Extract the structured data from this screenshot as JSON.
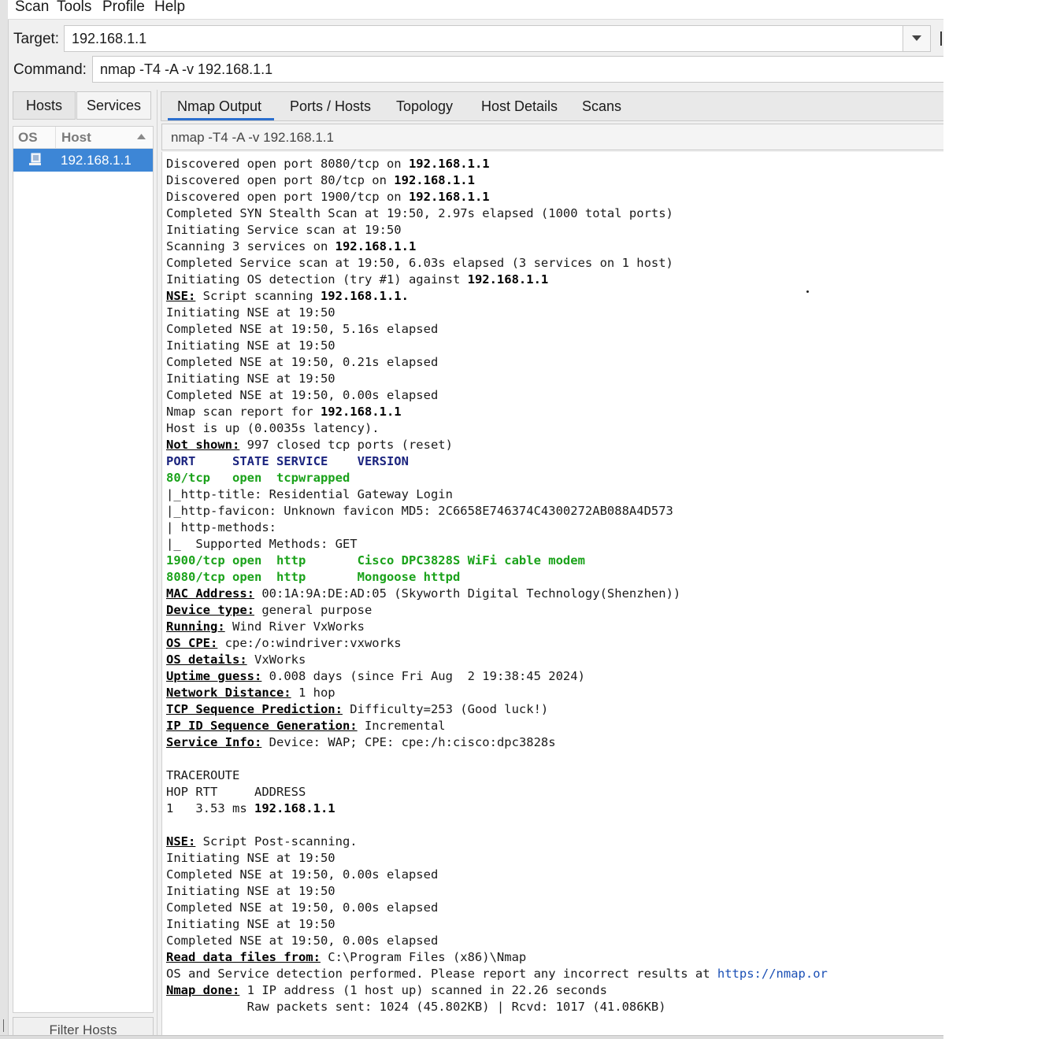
{
  "menu": [
    "Scan",
    "Tools",
    "Profile",
    "Help"
  ],
  "target": {
    "label": "Target:",
    "value": "192.168.1.1"
  },
  "command": {
    "label": "Command:",
    "value": "nmap -T4 -A -v 192.168.1.1"
  },
  "left_tabs": {
    "hosts": "Hosts",
    "services": "Services"
  },
  "host_list": {
    "col_os": "OS",
    "col_host": "Host",
    "rows": [
      {
        "host": "192.168.1.1",
        "icon": "computer-icon"
      }
    ]
  },
  "filter_hosts": "Filter Hosts",
  "right_tabs": [
    "Nmap Output",
    "Ports / Hosts",
    "Topology",
    "Host Details",
    "Scans"
  ],
  "active_tab": "Nmap Output",
  "scan_select": "nmap -T4 -A -v 192.168.1.1",
  "output_lines": [
    [
      {
        "t": "Discovered open port 8080/tcp on "
      },
      {
        "t": "192.168.1.1",
        "s": "b"
      }
    ],
    [
      {
        "t": "Discovered open port 80/tcp on "
      },
      {
        "t": "192.168.1.1",
        "s": "b"
      }
    ],
    [
      {
        "t": "Discovered open port 1900/tcp on "
      },
      {
        "t": "192.168.1.1",
        "s": "b"
      }
    ],
    [
      {
        "t": "Completed SYN Stealth Scan at 19:50, 2.97s elapsed (1000 total ports)"
      }
    ],
    [
      {
        "t": "Initiating Service scan at 19:50"
      }
    ],
    [
      {
        "t": "Scanning 3 services on "
      },
      {
        "t": "192.168.1.1",
        "s": "b"
      }
    ],
    [
      {
        "t": "Completed Service scan at 19:50, 6.03s elapsed (3 services on 1 host)"
      }
    ],
    [
      {
        "t": "Initiating OS detection (try #1) against "
      },
      {
        "t": "192.168.1.1",
        "s": "b"
      }
    ],
    [
      {
        "t": "NSE:",
        "s": "u"
      },
      {
        "t": " Script scanning "
      },
      {
        "t": "192.168.1.1.",
        "s": "b"
      }
    ],
    [
      {
        "t": "Initiating NSE at 19:50"
      }
    ],
    [
      {
        "t": "Completed NSE at 19:50, 5.16s elapsed"
      }
    ],
    [
      {
        "t": "Initiating NSE at 19:50"
      }
    ],
    [
      {
        "t": "Completed NSE at 19:50, 0.21s elapsed"
      }
    ],
    [
      {
        "t": "Initiating NSE at 19:50"
      }
    ],
    [
      {
        "t": "Completed NSE at 19:50, 0.00s elapsed"
      }
    ],
    [
      {
        "t": "Nmap scan report for "
      },
      {
        "t": "192.168.1.1",
        "s": "b"
      }
    ],
    [
      {
        "t": "Host is up (0.0035s latency)."
      }
    ],
    [
      {
        "t": "Not shown:",
        "s": "u"
      },
      {
        "t": " 997 closed tcp ports (reset)"
      }
    ],
    [
      {
        "t": "PORT     STATE SERVICE    VERSION",
        "s": "hdr"
      }
    ],
    [
      {
        "t": "80/tcp   open  tcpwrapped",
        "s": "g"
      }
    ],
    [
      {
        "t": "|_http-title: Residential Gateway Login"
      }
    ],
    [
      {
        "t": "|_http-favicon: Unknown favicon MD5: 2C6658E746374C4300272AB088A4D573"
      }
    ],
    [
      {
        "t": "| http-methods:"
      }
    ],
    [
      {
        "t": "|_  Supported Methods: GET"
      }
    ],
    [
      {
        "t": "1900/tcp open  http       Cisco DPC3828S WiFi cable modem",
        "s": "g"
      }
    ],
    [
      {
        "t": "8080/tcp open  http       Mongoose httpd",
        "s": "g"
      }
    ],
    [
      {
        "t": "MAC Address:",
        "s": "u"
      },
      {
        "t": " 00:1A:9A:DE:AD:05 (Skyworth Digital Technology(Shenzhen))"
      }
    ],
    [
      {
        "t": "Device type:",
        "s": "u"
      },
      {
        "t": " general purpose"
      }
    ],
    [
      {
        "t": "Running:",
        "s": "u"
      },
      {
        "t": " Wind River VxWorks"
      }
    ],
    [
      {
        "t": "OS CPE:",
        "s": "u"
      },
      {
        "t": " cpe:/o:windriver:vxworks"
      }
    ],
    [
      {
        "t": "OS details:",
        "s": "u"
      },
      {
        "t": " VxWorks"
      }
    ],
    [
      {
        "t": "Uptime guess:",
        "s": "u"
      },
      {
        "t": " 0.008 days (since Fri Aug  2 19:38:45 2024)"
      }
    ],
    [
      {
        "t": "Network Distance:",
        "s": "u"
      },
      {
        "t": " 1 hop"
      }
    ],
    [
      {
        "t": "TCP Sequence Prediction:",
        "s": "u"
      },
      {
        "t": " Difficulty=253 (Good luck!)"
      }
    ],
    [
      {
        "t": "IP ID Sequence Generation:",
        "s": "u"
      },
      {
        "t": " Incremental"
      }
    ],
    [
      {
        "t": "Service Info:",
        "s": "u"
      },
      {
        "t": " Device: WAP; CPE: cpe:/h:cisco:dpc3828s"
      }
    ],
    [
      {
        "t": ""
      }
    ],
    [
      {
        "t": "TRACEROUTE"
      }
    ],
    [
      {
        "t": "HOP RTT     ADDRESS"
      }
    ],
    [
      {
        "t": "1   3.53 ms "
      },
      {
        "t": "192.168.1.1",
        "s": "b"
      }
    ],
    [
      {
        "t": ""
      }
    ],
    [
      {
        "t": "NSE:",
        "s": "u"
      },
      {
        "t": " Script Post-scanning."
      }
    ],
    [
      {
        "t": "Initiating NSE at 19:50"
      }
    ],
    [
      {
        "t": "Completed NSE at 19:50, 0.00s elapsed"
      }
    ],
    [
      {
        "t": "Initiating NSE at 19:50"
      }
    ],
    [
      {
        "t": "Completed NSE at 19:50, 0.00s elapsed"
      }
    ],
    [
      {
        "t": "Initiating NSE at 19:50"
      }
    ],
    [
      {
        "t": "Completed NSE at 19:50, 0.00s elapsed"
      }
    ],
    [
      {
        "t": "Read data files from:",
        "s": "u"
      },
      {
        "t": " C:\\Program Files (x86)\\Nmap"
      }
    ],
    [
      {
        "t": "OS and Service detection performed. Please report any incorrect results at "
      },
      {
        "t": "https://nmap.or",
        "s": "link"
      }
    ],
    [
      {
        "t": "Nmap done:",
        "s": "u"
      },
      {
        "t": " 1 IP address (1 host up) scanned in 22.26 seconds"
      }
    ],
    [
      {
        "t": "           Raw packets sent: 1024 (45.802KB) | Rcvd: 1017 (41.086KB)"
      }
    ]
  ],
  "colors": {
    "selection": "#3d86d6",
    "tab_indicator": "#2b6fce",
    "open_port": "#1aa21a",
    "port_header": "#1a237e",
    "link": "#1a4fb5"
  }
}
